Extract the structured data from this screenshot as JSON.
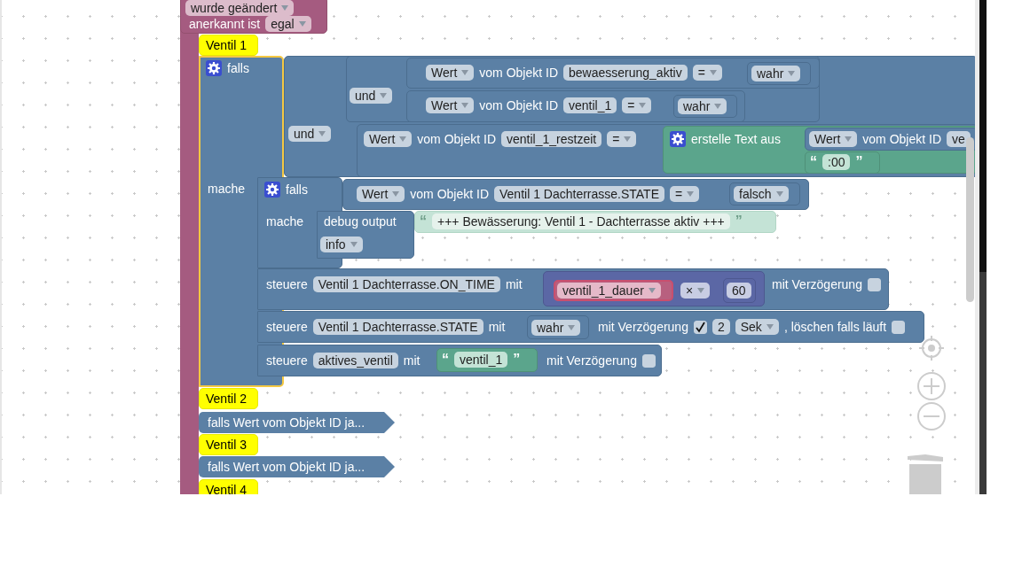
{
  "blocks": [
    {
      "kind": "trigger",
      "selected": false,
      "groups": [
        [
          {
            "kind": "dropdown",
            "text": "wurde geändert"
          }
        ],
        [
          {
            "kind": "label",
            "text": "anerkannt ist"
          },
          {
            "kind": "dropdown",
            "text": "egal"
          }
        ]
      ]
    },
    {
      "kind": "comment",
      "selected": false,
      "groups": [
        [
          {
            "kind": "label",
            "text": "Ventil 1"
          }
        ]
      ]
    },
    {
      "kind": "statement",
      "selected": true,
      "groups": [
        [
          {
            "kind": "gear"
          },
          {
            "kind": "label",
            "text": "falls"
          }
        ],
        [
          {
            "kind": "label",
            "text": "mache"
          }
        ]
      ],
      "children": [
        {
          "kind": "value",
          "selected": false,
          "groups": [
            [
              {
                "kind": "dropdown",
                "text": "und"
              }
            ]
          ],
          "children": [
            {
              "kind": "value",
              "selected": false,
              "groups": [
                [
                  {
                    "kind": "dropdown",
                    "text": "und"
                  }
                ]
              ],
              "children": [
                {
                  "kind": "value",
                  "selected": false,
                  "groups": [
                    [
                      {
                        "kind": "dropdown",
                        "text": "Wert"
                      },
                      {
                        "kind": "label",
                        "text": "vom Objekt ID"
                      },
                      {
                        "kind": "field",
                        "text": "bewaesserung_aktiv"
                      },
                      {
                        "kind": "dropdown",
                        "text": "="
                      }
                    ]
                  ],
                  "children": [
                    {
                      "kind": "value",
                      "selected": false,
                      "groups": [
                        [
                          {
                            "kind": "dropdown",
                            "text": "wahr"
                          }
                        ]
                      ]
                    }
                  ]
                },
                {
                  "kind": "value",
                  "selected": false,
                  "groups": [
                    [
                      {
                        "kind": "dropdown",
                        "text": "Wert"
                      },
                      {
                        "kind": "label",
                        "text": "vom Objekt ID"
                      },
                      {
                        "kind": "field",
                        "text": "ventil_1"
                      },
                      {
                        "kind": "dropdown",
                        "text": "="
                      }
                    ]
                  ],
                  "children": [
                    {
                      "kind": "value",
                      "selected": false,
                      "groups": [
                        [
                          {
                            "kind": "dropdown",
                            "text": "wahr"
                          }
                        ]
                      ]
                    }
                  ]
                }
              ]
            },
            {
              "kind": "value",
              "selected": false,
              "groups": [
                [
                  {
                    "kind": "dropdown",
                    "text": "Wert"
                  },
                  {
                    "kind": "label",
                    "text": "vom Objekt ID"
                  },
                  {
                    "kind": "field",
                    "text": "ventil_1_restzeit"
                  },
                  {
                    "kind": "dropdown",
                    "text": "="
                  }
                ]
              ],
              "children": [
                {
                  "kind": "text",
                  "selected": false,
                  "groups": [
                    [
                      {
                        "kind": "gear"
                      },
                      {
                        "kind": "label",
                        "text": "erstelle Text aus"
                      }
                    ]
                  ],
                  "children": [
                    {
                      "kind": "value",
                      "selected": false,
                      "groups": [
                        [
                          {
                            "kind": "dropdown",
                            "text": "Wert"
                          },
                          {
                            "kind": "label",
                            "text": "vom Objekt ID"
                          },
                          {
                            "kind": "field",
                            "text": "ve"
                          }
                        ]
                      ]
                    },
                    {
                      "kind": "text",
                      "selected": false,
                      "groups": [
                        [
                          {
                            "kind": "quote",
                            "text": "“"
                          },
                          {
                            "kind": "field",
                            "text": ":00"
                          },
                          {
                            "kind": "quote",
                            "text": "”"
                          }
                        ]
                      ]
                    }
                  ]
                }
              ]
            }
          ]
        },
        {
          "kind": "statement",
          "selected": false,
          "groups": [
            [
              {
                "kind": "gear"
              },
              {
                "kind": "label",
                "text": "falls"
              }
            ],
            [
              {
                "kind": "label",
                "text": "mache"
              }
            ]
          ],
          "children": [
            {
              "kind": "value",
              "selected": false,
              "groups": [
                [
                  {
                    "kind": "dropdown",
                    "text": "Wert"
                  },
                  {
                    "kind": "label",
                    "text": "vom Objekt ID"
                  },
                  {
                    "kind": "field",
                    "text": "Ventil 1 Dachterrasse.STATE"
                  },
                  {
                    "kind": "dropdown",
                    "text": "="
                  }
                ]
              ],
              "children": [
                {
                  "kind": "value",
                  "selected": false,
                  "groups": [
                    [
                      {
                        "kind": "dropdown",
                        "text": "falsch"
                      }
                    ]
                  ]
                }
              ]
            },
            {
              "kind": "statement",
              "selected": false,
              "groups": [
                [
                  {
                    "kind": "label",
                    "text": "debug output"
                  }
                ],
                [
                  {
                    "kind": "dropdown",
                    "text": "info"
                  }
                ]
              ],
              "children": [
                {
                  "kind": "shadow_text",
                  "selected": false,
                  "groups": [
                    [
                      {
                        "kind": "quote",
                        "text": "“"
                      },
                      {
                        "kind": "field",
                        "text": "+++ Bewässerung: Ventil 1 - Dachterrasse aktiv +++"
                      },
                      {
                        "kind": "quote",
                        "text": "”"
                      }
                    ]
                  ]
                }
              ]
            }
          ]
        },
        {
          "kind": "statement",
          "selected": false,
          "groups": [
            [
              {
                "kind": "label",
                "text": "steuere"
              },
              {
                "kind": "field",
                "text": "Ventil 1 Dachterrasse.ON_TIME"
              },
              {
                "kind": "label",
                "text": "mit"
              }
            ],
            [
              {
                "kind": "label",
                "text": "mit Verzögerung"
              },
              {
                "kind": "checkbox",
                "checked": false
              }
            ]
          ],
          "children": [
            {
              "kind": "math",
              "selected": false,
              "groups": [
                [
                  {
                    "kind": "dropdown",
                    "text": "×"
                  }
                ]
              ],
              "children": [
                {
                  "kind": "variable",
                  "selected": false,
                  "groups": [
                    [
                      {
                        "kind": "dropdown",
                        "text": "ventil_1_dauer"
                      }
                    ]
                  ]
                },
                {
                  "kind": "math",
                  "selected": false,
                  "groups": [
                    [
                      {
                        "kind": "field",
                        "text": "60"
                      }
                    ]
                  ]
                }
              ]
            }
          ]
        },
        {
          "kind": "statement",
          "selected": false,
          "groups": [
            [
              {
                "kind": "label",
                "text": "steuere"
              },
              {
                "kind": "field",
                "text": "Ventil 1 Dachterrasse.STATE"
              },
              {
                "kind": "label",
                "text": "mit"
              }
            ],
            [
              {
                "kind": "label",
                "text": "mit Verzögerung"
              },
              {
                "kind": "checkbox",
                "checked": true
              },
              {
                "kind": "field",
                "text": "2"
              },
              {
                "kind": "dropdown",
                "text": "Sek"
              },
              {
                "kind": "label",
                "text": ", löschen falls läuft"
              },
              {
                "kind": "checkbox",
                "checked": false
              }
            ]
          ],
          "children": [
            {
              "kind": "value",
              "selected": false,
              "groups": [
                [
                  {
                    "kind": "dropdown",
                    "text": "wahr"
                  }
                ]
              ]
            }
          ]
        },
        {
          "kind": "statement",
          "selected": false,
          "groups": [
            [
              {
                "kind": "label",
                "text": "steuere"
              },
              {
                "kind": "field",
                "text": "aktives_ventil"
              },
              {
                "kind": "label",
                "text": "mit"
              }
            ],
            [
              {
                "kind": "label",
                "text": "mit Verzögerung"
              },
              {
                "kind": "checkbox",
                "checked": false
              }
            ]
          ],
          "children": [
            {
              "kind": "text",
              "selected": false,
              "groups": [
                [
                  {
                    "kind": "quote",
                    "text": "“"
                  },
                  {
                    "kind": "field",
                    "text": "ventil_1"
                  },
                  {
                    "kind": "quote",
                    "text": "”"
                  }
                ]
              ]
            }
          ]
        }
      ]
    },
    {
      "kind": "comment",
      "selected": false,
      "groups": [
        [
          {
            "kind": "label",
            "text": "Ventil 2"
          }
        ]
      ]
    },
    {
      "kind": "collapsed",
      "selected": false,
      "groups": [
        [
          {
            "kind": "label",
            "text": "falls Wert vom Objekt ID ja..."
          }
        ]
      ]
    },
    {
      "kind": "comment",
      "selected": false,
      "groups": [
        [
          {
            "kind": "label",
            "text": "Ventil 3"
          }
        ]
      ]
    },
    {
      "kind": "collapsed",
      "selected": false,
      "groups": [
        [
          {
            "kind": "label",
            "text": "falls Wert vom Objekt ID ja..."
          }
        ]
      ]
    },
    {
      "kind": "comment",
      "selected": false,
      "groups": [
        [
          {
            "kind": "label",
            "text": "Ventil 4"
          }
        ]
      ]
    }
  ]
}
